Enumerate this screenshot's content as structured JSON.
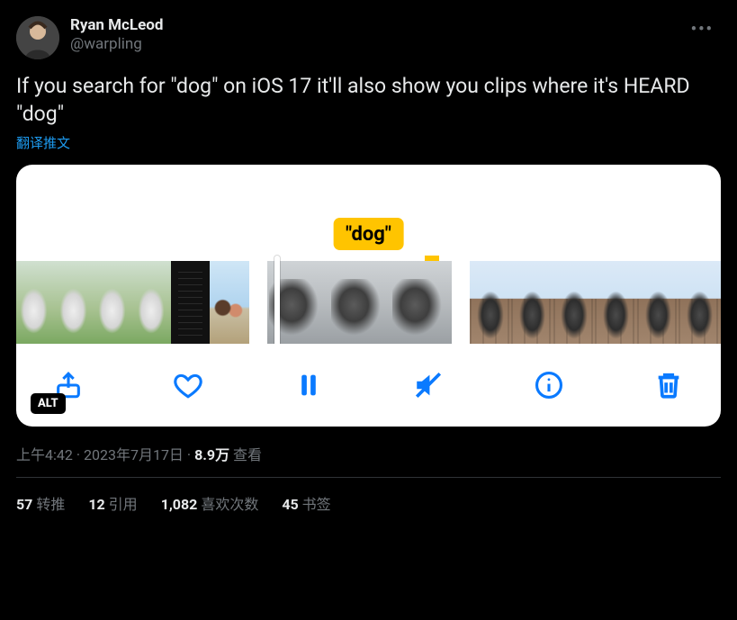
{
  "author": {
    "display_name": "Ryan McLeod",
    "handle": "@warpling"
  },
  "body_text": "If you search for \"dog\" on iOS 17 it'll also show you clips where it's HEARD \"dog\"",
  "translate_label": "翻译推文",
  "media": {
    "search_term_pill": "\"dog\"",
    "alt_badge": "ALT",
    "toolbar": {
      "share": "share",
      "like": "like",
      "pause": "pause",
      "mute": "mute",
      "info": "info",
      "trash": "trash"
    }
  },
  "meta": {
    "time": "上午4:42",
    "date": "2023年7月17日",
    "views_value": "8.9万",
    "views_label": "查看",
    "sep": " · "
  },
  "stats": {
    "retweets": {
      "value": "57",
      "label": "转推"
    },
    "quotes": {
      "value": "12",
      "label": "引用"
    },
    "likes": {
      "value": "1,082",
      "label": "喜欢次数"
    },
    "bookmarks": {
      "value": "45",
      "label": "书签"
    }
  }
}
